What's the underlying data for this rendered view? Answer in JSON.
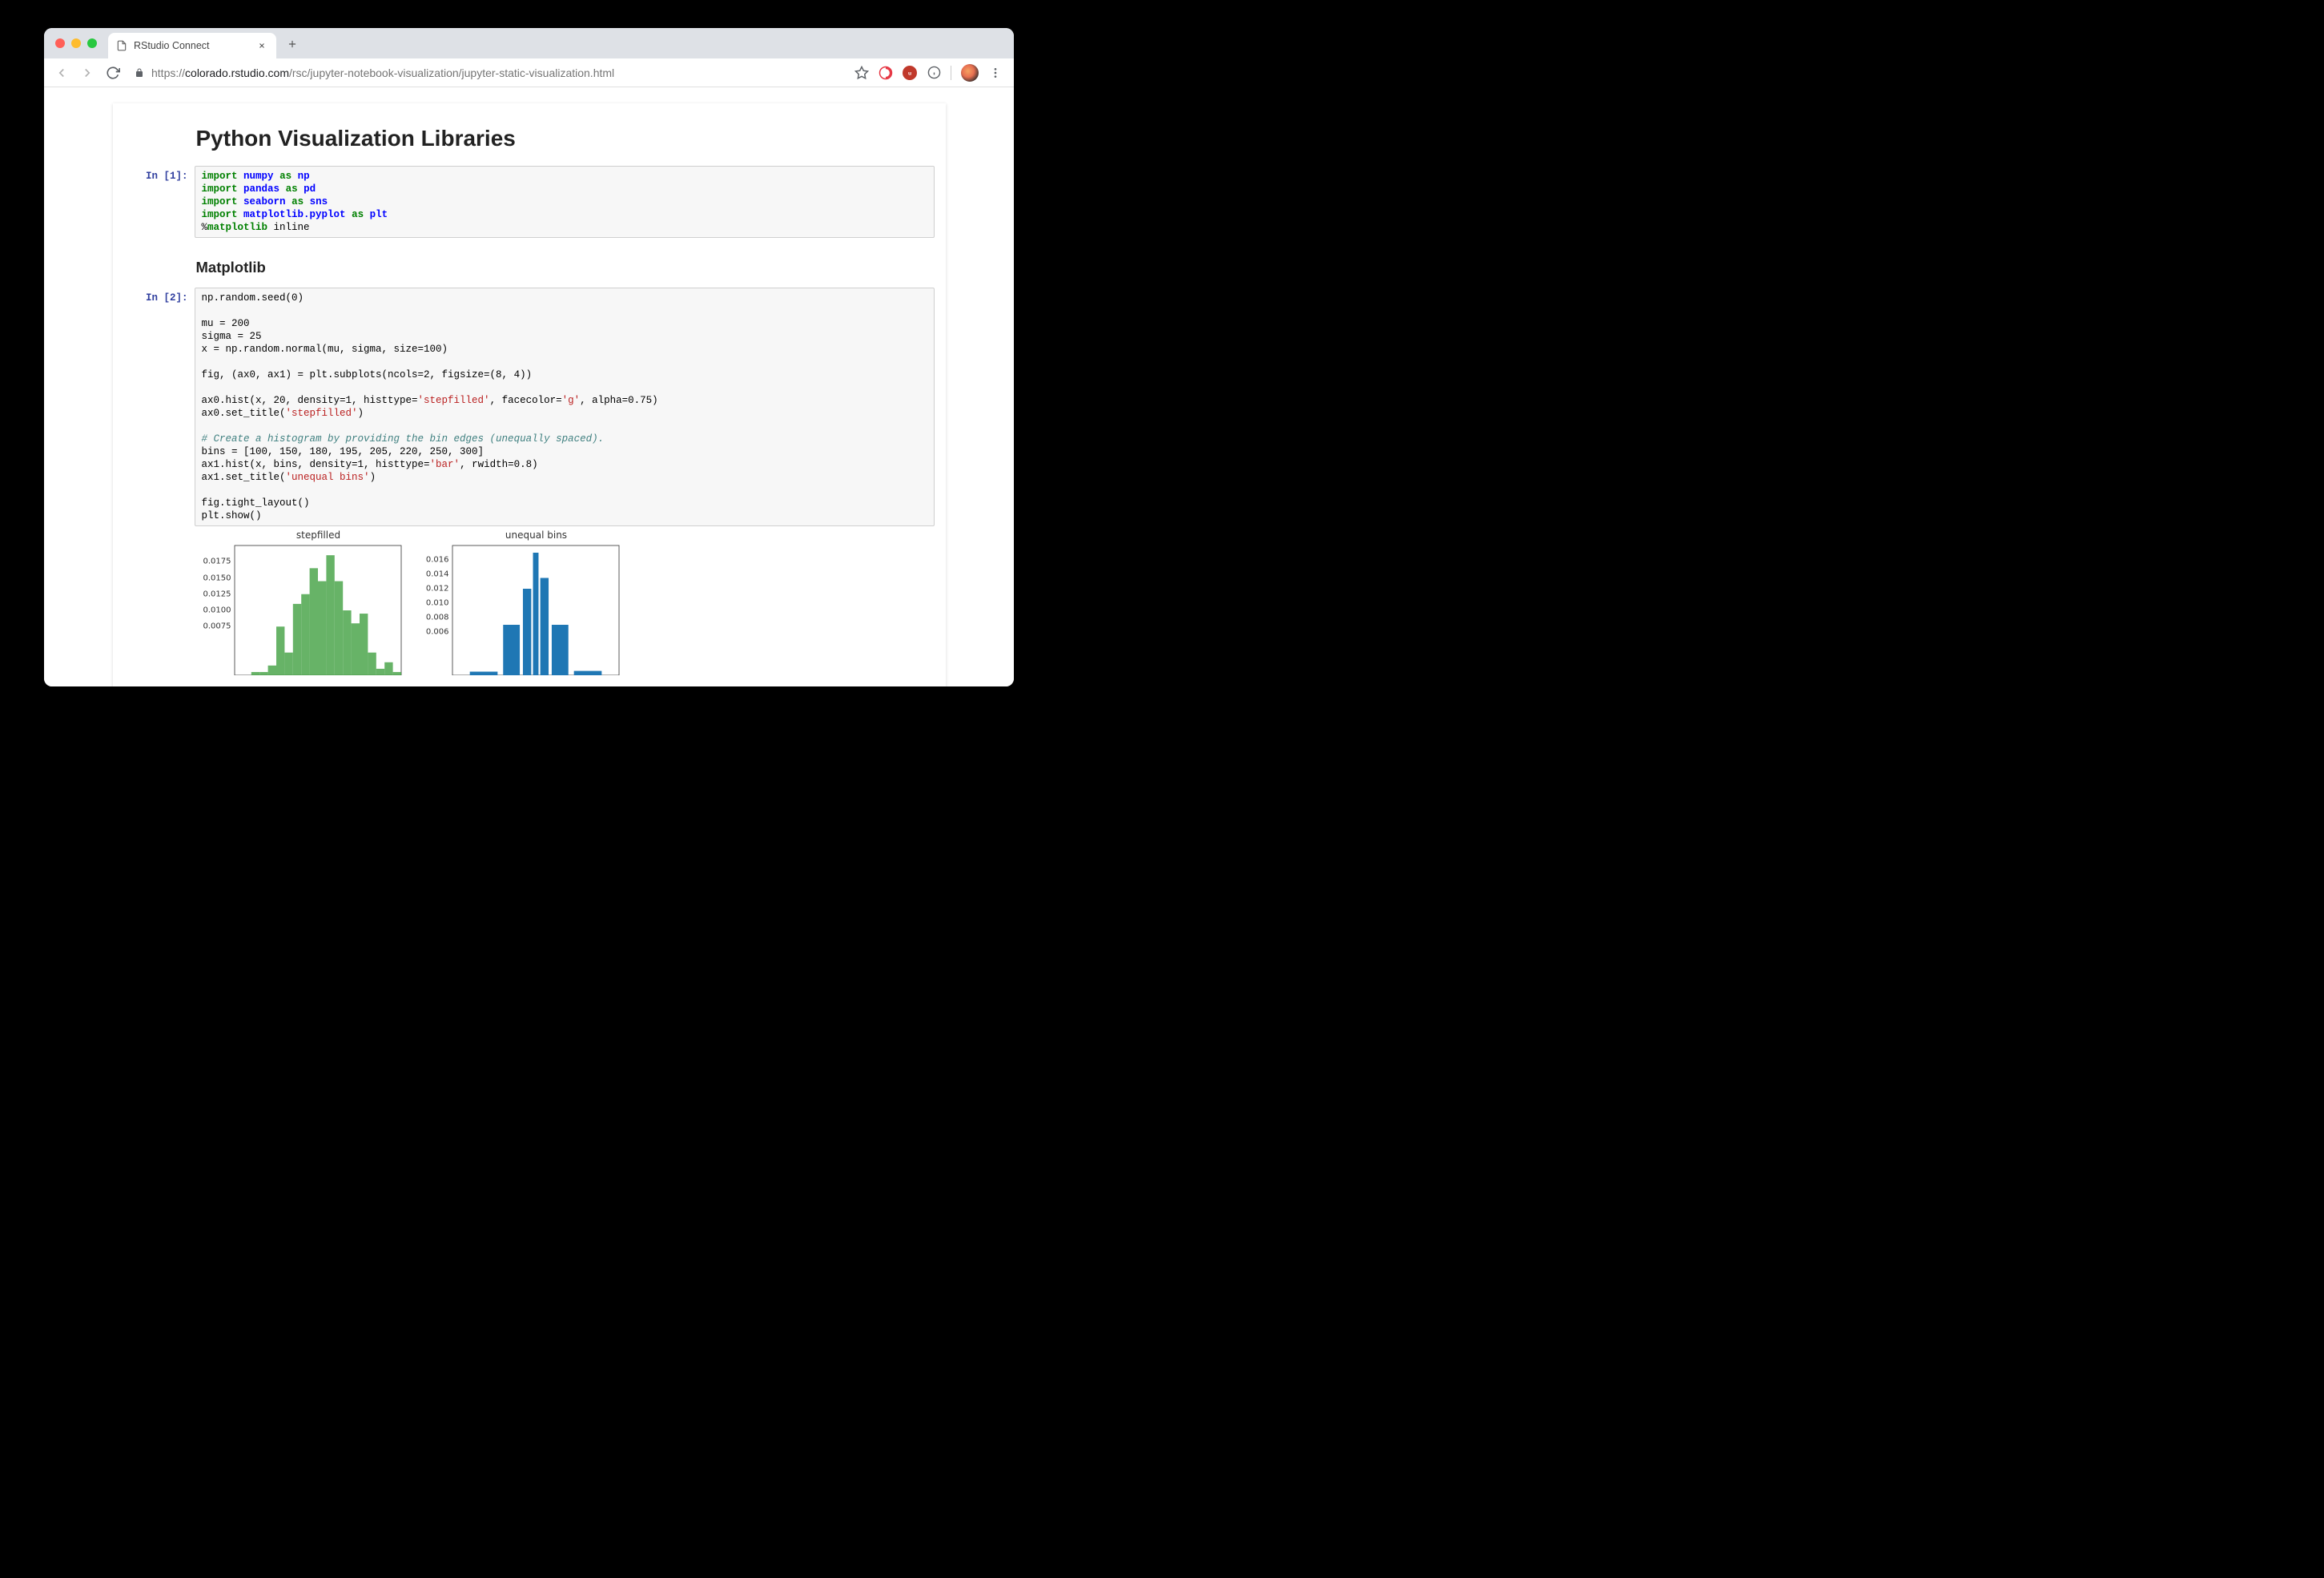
{
  "browser": {
    "tab_title": "RStudio Connect",
    "url_scheme": "https://",
    "url_domain": "colorado.rstudio.com",
    "url_path": "/rsc/jupyter-notebook-visualization/jupyter-static-visualization.html"
  },
  "notebook": {
    "title": "Python Visualization Libraries",
    "prompt1": "In [1]:",
    "prompt2": "In [2]:",
    "sub_matplotlib": "Matplotlib",
    "code1": {
      "l1_kw": "import",
      "l1_mod": "numpy",
      "l1_as": "as",
      "l1_alias": "np",
      "l2_kw": "import",
      "l2_mod": "pandas",
      "l2_as": "as",
      "l2_alias": "pd",
      "l3_kw": "import",
      "l3_mod": "seaborn",
      "l3_as": "as",
      "l3_alias": "sns",
      "l4_kw": "import",
      "l4_mod": "matplotlib.pyplot",
      "l4_as": "as",
      "l4_alias": "plt",
      "l5_magic": "%",
      "l5_cmd": "matplotlib",
      "l5_arg": " inline"
    },
    "code2": {
      "l1": "np.random.seed(0)",
      "l3": "mu = 200",
      "l4": "sigma = 25",
      "l5": "x = np.random.normal(mu, sigma, size=100)",
      "l7": "fig, (ax0, ax1) = plt.subplots(ncols=2, figsize=(8, 4))",
      "l9a": "ax0.hist(x, 20, density=1, histtype=",
      "l9s1": "'stepfilled'",
      "l9b": ", facecolor=",
      "l9s2": "'g'",
      "l9c": ", alpha=0.75)",
      "l10a": "ax0.set_title(",
      "l10s": "'stepfilled'",
      "l10b": ")",
      "l12c": "# Create a histogram by providing the bin edges (unequally spaced).",
      "l13": "bins = [100, 150, 180, 195, 205, 220, 250, 300]",
      "l14a": "ax1.hist(x, bins, density=1, histtype=",
      "l14s": "'bar'",
      "l14b": ", rwidth=0.8)",
      "l15a": "ax1.set_title(",
      "l15s": "'unequal bins'",
      "l15b": ")",
      "l17": "fig.tight_layout()",
      "l18": "plt.show()"
    }
  },
  "chart_data": [
    {
      "type": "bar",
      "title": "stepfilled",
      "color": "#4ca64c",
      "xlim": [
        120,
        270
      ],
      "ylim": [
        0,
        0.02
      ],
      "yticks": [
        0.0075,
        0.01,
        0.0125,
        0.015,
        0.0175
      ],
      "ytick_labels": [
        "0.0075",
        "0.0100",
        "0.0125",
        "0.0150",
        "0.0175"
      ],
      "bin_width": 7.5,
      "bins": [
        {
          "x": 135,
          "y": 0.0005
        },
        {
          "x": 142.5,
          "y": 0.0005
        },
        {
          "x": 150,
          "y": 0.0015
        },
        {
          "x": 157.5,
          "y": 0.0075
        },
        {
          "x": 165,
          "y": 0.0035
        },
        {
          "x": 172.5,
          "y": 0.011
        },
        {
          "x": 180,
          "y": 0.0125
        },
        {
          "x": 187.5,
          "y": 0.0165
        },
        {
          "x": 195,
          "y": 0.0145
        },
        {
          "x": 202.5,
          "y": 0.0185
        },
        {
          "x": 210,
          "y": 0.0145
        },
        {
          "x": 217.5,
          "y": 0.01
        },
        {
          "x": 225,
          "y": 0.008
        },
        {
          "x": 232.5,
          "y": 0.0095
        },
        {
          "x": 240,
          "y": 0.0035
        },
        {
          "x": 247.5,
          "y": 0.001
        },
        {
          "x": 255,
          "y": 0.002
        },
        {
          "x": 262.5,
          "y": 0.0005
        }
      ]
    },
    {
      "type": "bar",
      "title": "unequal bins",
      "color": "#1f77b4",
      "xlim": [
        80,
        320
      ],
      "ylim": [
        0,
        0.018
      ],
      "yticks": [
        0.006,
        0.008,
        0.01,
        0.012,
        0.014,
        0.016
      ],
      "ytick_labels": [
        "0.006",
        "0.008",
        "0.010",
        "0.012",
        "0.014",
        "0.016"
      ],
      "rwidth": 0.8,
      "bins": [
        {
          "x0": 100,
          "x1": 150,
          "y": 0.0005
        },
        {
          "x0": 150,
          "x1": 180,
          "y": 0.007
        },
        {
          "x0": 180,
          "x1": 195,
          "y": 0.012
        },
        {
          "x0": 195,
          "x1": 205,
          "y": 0.017
        },
        {
          "x0": 205,
          "x1": 220,
          "y": 0.0135
        },
        {
          "x0": 220,
          "x1": 250,
          "y": 0.007
        },
        {
          "x0": 250,
          "x1": 300,
          "y": 0.0006
        }
      ]
    }
  ]
}
